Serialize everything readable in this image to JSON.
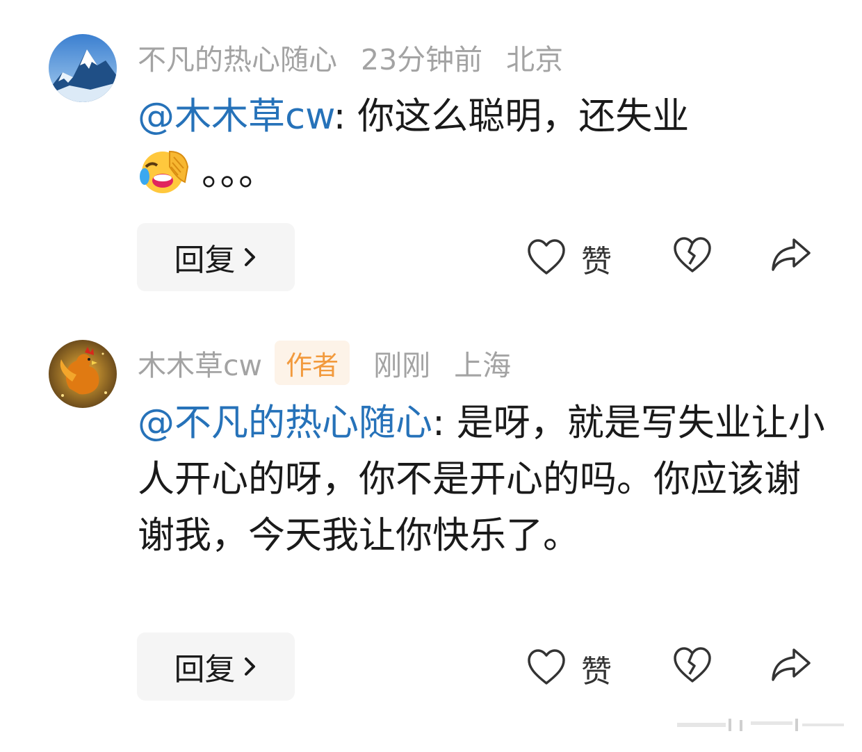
{
  "comments": [
    {
      "username": "不凡的热心随心",
      "time": "23分钟前",
      "location": "北京",
      "author_tag": "",
      "mention": "@木木草cw",
      "text": ": 你这么聪明，还失业",
      "text_after_emoji": "。。。",
      "emoji": "laughing-facepalm",
      "reply_label": "回复",
      "like_label": "赞"
    },
    {
      "username": "木木草cw",
      "time": "刚刚",
      "location": "上海",
      "author_tag": "作者",
      "mention": "@不凡的热心随心",
      "text": ": 是呀，就是写失业让小人开心的呀，你不是开心的吗。你应该谢谢我，今天我让你快乐了。",
      "reply_label": "回复",
      "like_label": "赞"
    }
  ],
  "colors": {
    "mention": "#2672b9",
    "meta": "#a3a3a3",
    "author_tag_bg": "#fdf3e8",
    "author_tag_text": "#f29a3d",
    "button_bg": "#f5f5f5"
  }
}
